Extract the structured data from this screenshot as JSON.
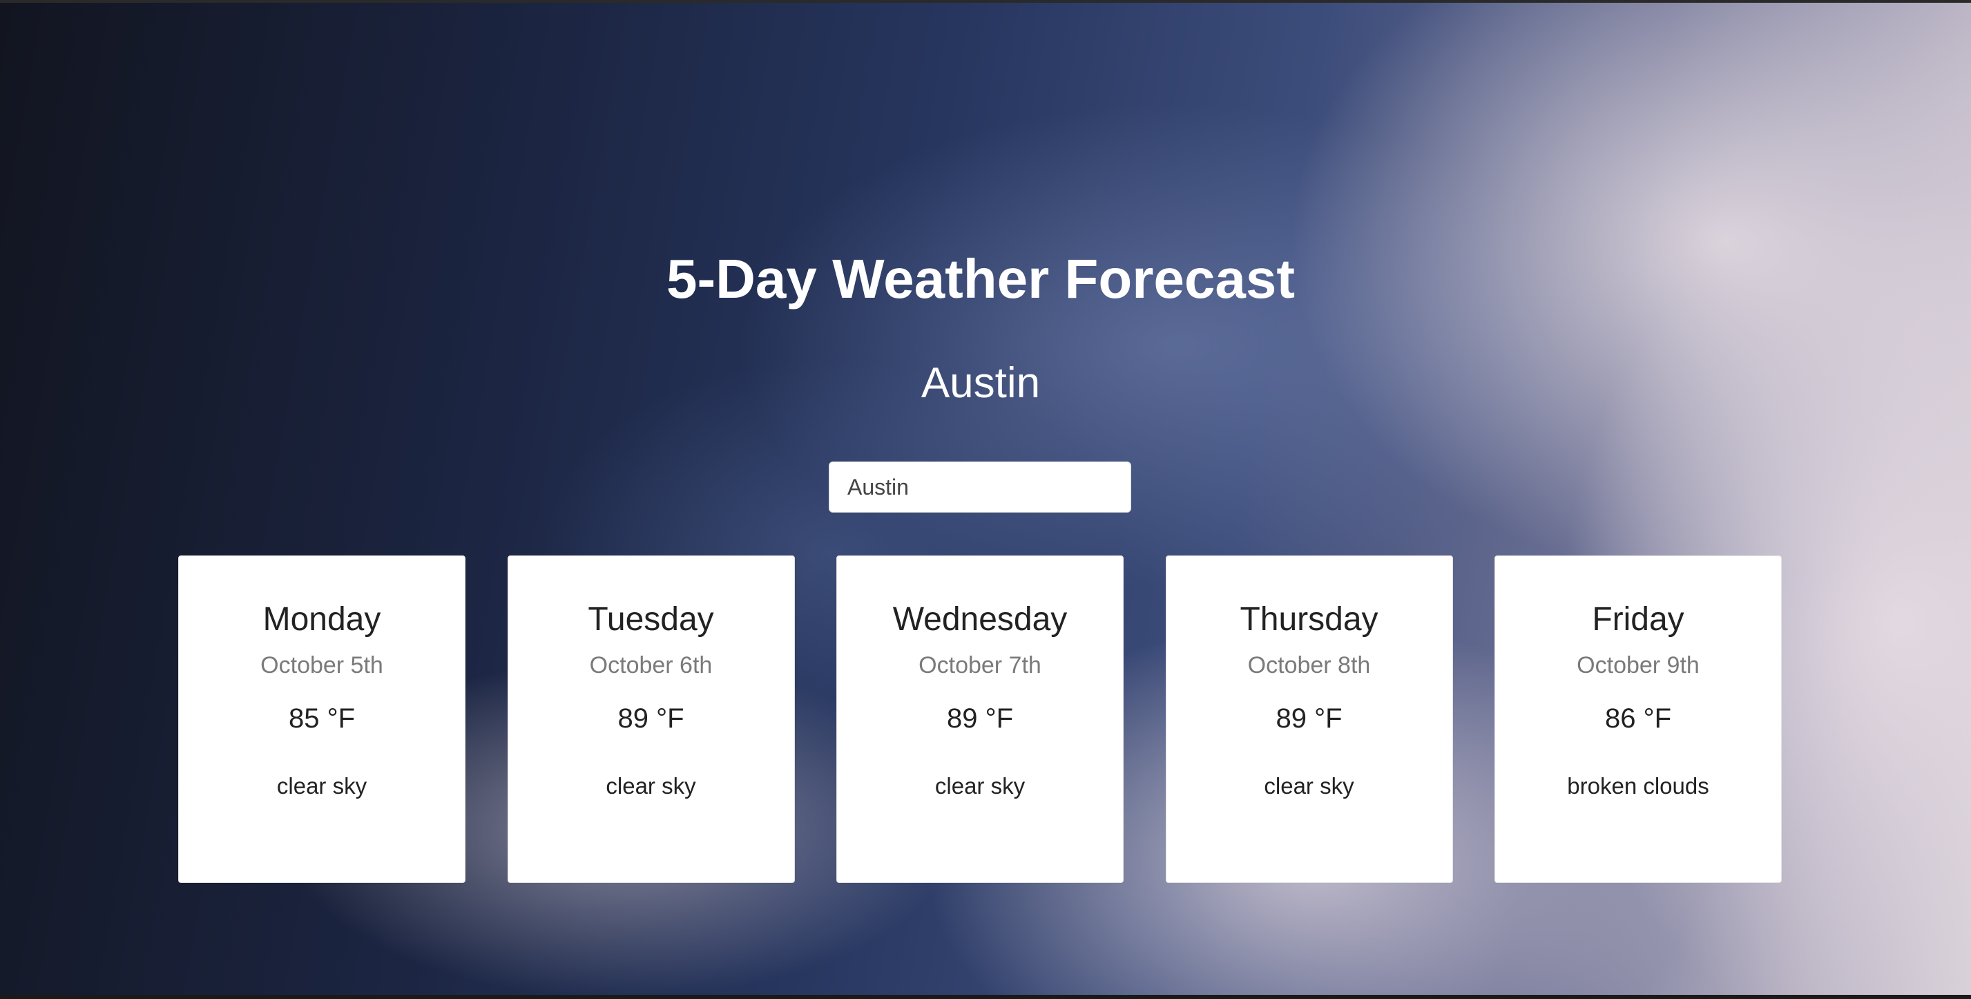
{
  "header": {
    "title": "5-Day Weather Forecast",
    "city": "Austin"
  },
  "search": {
    "value": "Austin"
  },
  "forecast": [
    {
      "day": "Monday",
      "date": "October 5th",
      "temp": "85 °F",
      "desc": "clear sky"
    },
    {
      "day": "Tuesday",
      "date": "October 6th",
      "temp": "89 °F",
      "desc": "clear sky"
    },
    {
      "day": "Wednesday",
      "date": "October 7th",
      "temp": "89 °F",
      "desc": "clear sky"
    },
    {
      "day": "Thursday",
      "date": "October 8th",
      "temp": "89 °F",
      "desc": "clear sky"
    },
    {
      "day": "Friday",
      "date": "October 9th",
      "temp": "86 °F",
      "desc": "broken clouds"
    }
  ]
}
